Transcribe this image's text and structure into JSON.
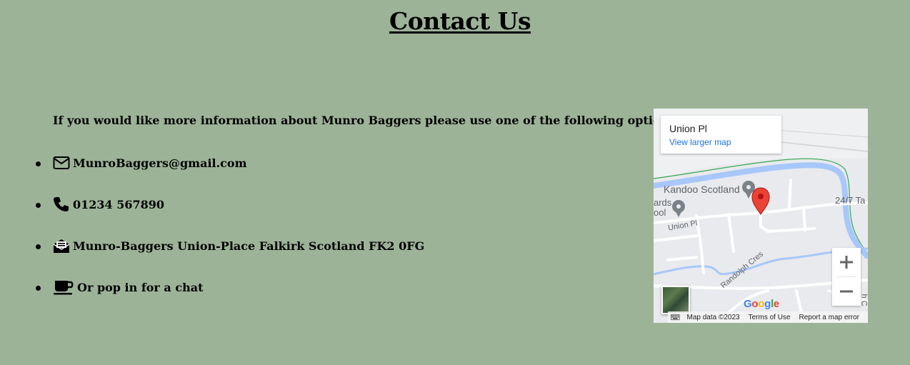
{
  "page": {
    "title": "Contact Us"
  },
  "contact": {
    "intro": "If you would like more information about Munro Baggers please use one of the following options",
    "items": [
      {
        "icon": "envelope-icon",
        "text": "MunroBaggers@gmail.com"
      },
      {
        "icon": "phone-icon",
        "text": "01234 567890"
      },
      {
        "icon": "open-envelope-icon",
        "text": "Munro-Baggers Union-Place Falkirk Scotland FK2 0FG"
      },
      {
        "icon": "coffee-cup-icon",
        "text": "Or pop in for a chat"
      }
    ]
  },
  "map": {
    "place_name": "Union Pl",
    "view_larger": "View larger map",
    "labels": {
      "kandoo": "Kandoo Scotland",
      "ards": "ards",
      "ool": "ool",
      "union_pl": "Union Pl",
      "randolph": "Randolph Cres",
      "twentyfour": "24/7 Ta",
      "edge": "h C"
    },
    "logo": {
      "g1": "G",
      "o1": "o",
      "o2": "o",
      "g2": "g",
      "l": "l",
      "e": "e"
    },
    "attribution": {
      "map_data": "Map data ©2023",
      "terms": "Terms of Use",
      "report": "Report a map error"
    },
    "colors": {
      "water": "#a8c7fa",
      "pin": "#ea4335",
      "park_edge": "#34a853"
    }
  },
  "colors": {
    "background": "#9db398"
  }
}
